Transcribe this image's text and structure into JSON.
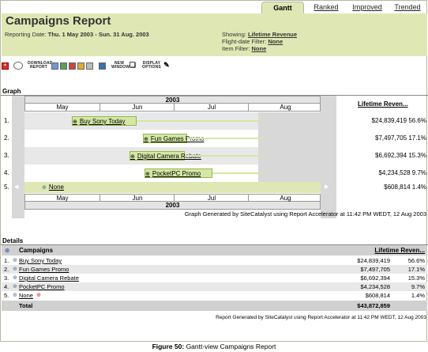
{
  "tabs": {
    "gantt": "Gantt",
    "ranked": "Ranked",
    "improved": "Improved",
    "trended": "Trended"
  },
  "header": {
    "title": "Campaigns Report",
    "reporting_label": "Reporting Date:",
    "reporting_value": "Thu. 1 May 2003 - Sun. 31 Aug. 2003",
    "showing_label": "Showing:",
    "showing_value": "Lifetime Revenue",
    "flight_label": "Flight-date Filter:",
    "flight_value": "None",
    "item_label": "Item Filter:",
    "item_value": "None"
  },
  "toolbar": {
    "download_label": "DOWNLOAD REPORT",
    "new_window_label": "NEW WINDOW",
    "display_label": "DISPLAY OPTIONS"
  },
  "graph": {
    "section_title": "Graph",
    "year": "2003",
    "months": [
      "May",
      "Jun",
      "Jul",
      "Aug"
    ],
    "metric_header": "Lifetime Reven...",
    "rows": [
      {
        "num": "1.",
        "name": "Buy Sony Today",
        "value": "$24,839,419",
        "pct": "56.6%"
      },
      {
        "num": "2.",
        "name": "Fun Games Promo",
        "value": "$7,497,705",
        "pct": "17.1%"
      },
      {
        "num": "3.",
        "name": "Digital Camera Rebate",
        "value": "$6,692,394",
        "pct": "15.3%"
      },
      {
        "num": "4.",
        "name": "PocketPC Promo",
        "value": "$4,234,528",
        "pct": "9.7%"
      },
      {
        "num": "5.",
        "name": "None",
        "value": "$608,814",
        "pct": "1.4%"
      }
    ],
    "footer": "Graph Generated by SiteCatalyst using Report Accelerator at 11:42 PM WEDT, 12 Aug 2003"
  },
  "details": {
    "section_title": "Details",
    "col_name": "Campaigns",
    "col_metric": "Lifetime Reven...",
    "rows": [
      {
        "num": "1.",
        "name": "Buy Sony Today",
        "value": "$24,839,419",
        "pct": "56.6%"
      },
      {
        "num": "2.",
        "name": "Fun Games Promo",
        "value": "$7,497,705",
        "pct": "17.1%"
      },
      {
        "num": "3.",
        "name": "Digital Camera Rebate",
        "value": "$6,692,394",
        "pct": "15.3%"
      },
      {
        "num": "4.",
        "name": "PocketPC Promo",
        "value": "$4,234,528",
        "pct": "9.7%"
      },
      {
        "num": "5.",
        "name": "None",
        "value": "$608,814",
        "pct": "1.4%"
      }
    ],
    "total_label": "Total",
    "total_value": "$43,872,859",
    "footer": "Report Generated by SiteCatalyst using Report Accelerator at 11:42 PM WEDT, 12 Aug 2003"
  },
  "caption": {
    "label": "Figure 50:",
    "text": "Gantt-view Campaigns Report"
  },
  "colors": {
    "band": "#dfe8b4",
    "bar_fill": "#d4e8a6",
    "bar_border": "#98b34f",
    "row_alt": "#e8e8e8"
  }
}
